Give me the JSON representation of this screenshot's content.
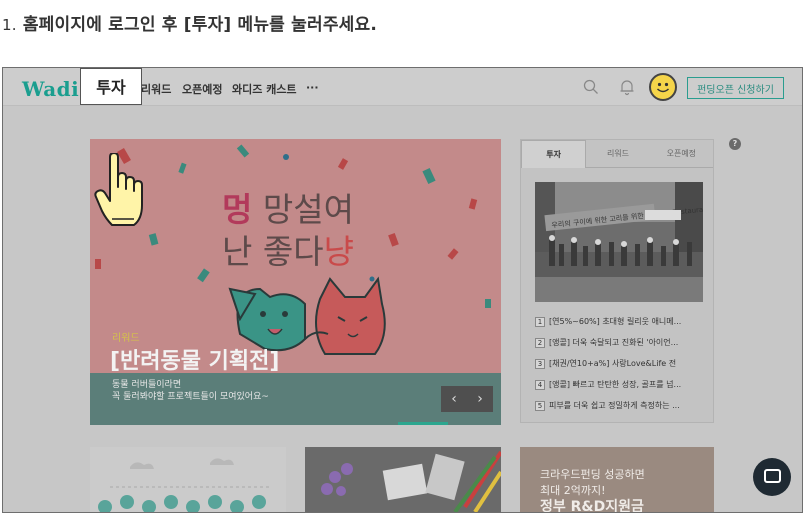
{
  "instruction": {
    "number": "1.",
    "text": "홈페이지에 로그인 후 [투자] 메뉴를 눌러주세요."
  },
  "header": {
    "logo": "Wadiz",
    "nav": [
      "투자",
      "리워드",
      "오픈예정",
      "와디즈 캐스트",
      "···"
    ],
    "apply_button": "펀딩오픈 신청하기"
  },
  "hero": {
    "title_line1_accent": "멍",
    "title_line1_rest": " 망설여",
    "title_line2_rest": "난 좋다",
    "title_line2_accent": "냥",
    "tag": "리워드",
    "heading": "[반려동물 기획전]",
    "desc_line1": "동물 러버들이라면",
    "desc_line2": "꼭 둘러봐야할 프로젝트들이 모여있어요~",
    "prev": "‹",
    "next": "›"
  },
  "side_panel": {
    "tabs": [
      "투자",
      "리워드",
      "오픈예정"
    ],
    "active_tab": "투자",
    "ranking": [
      {
        "n": "1",
        "text": "[연5%~60%] 초대형 릴리웃 애니메..."
      },
      {
        "n": "2",
        "text": "[앵콜] 더욱 숙달되고 진화된 '아이언..."
      },
      {
        "n": "3",
        "text": "[채권/연10+a%] 사랑Love&Life 전"
      },
      {
        "n": "4",
        "text": "[앵콜] 빠르고 탄탄한 성장, 골프를 넘..."
      },
      {
        "n": "5",
        "text": "피부를 더욱 쉽고 정밀하게 측정하는 ..."
      }
    ],
    "photo_banner": "우리의 구이에 위한 고리들 위한 Korean Restaurant",
    "help": "?"
  },
  "cards": {
    "card3_line1": "크라우드펀딩 성공하면",
    "card3_line2": "최대 2억까지!",
    "card3_line3": "정부 R&D지원금"
  },
  "colors": {
    "brand": "#1a9e8f",
    "accent": "#b23a5b",
    "hero_bg": "#c38a8a",
    "hero_bottom": "#5b7e79",
    "dim_overlay": "#c7c7c7"
  }
}
